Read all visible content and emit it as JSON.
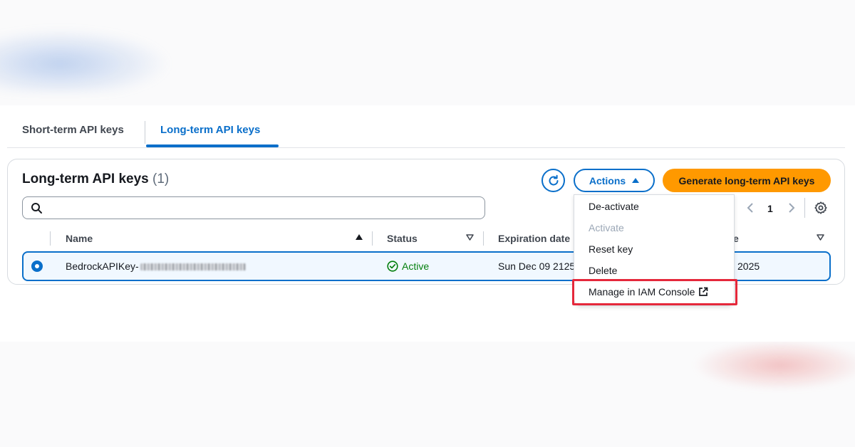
{
  "tabs": {
    "short_term": "Short-term API keys",
    "long_term": "Long-term API keys",
    "active": "long_term"
  },
  "card": {
    "title": "Long-term API keys",
    "count": "(1)"
  },
  "toolbar": {
    "refresh_icon": "refresh-icon",
    "actions_label": "Actions",
    "generate_label": "Generate long-term API keys"
  },
  "search": {
    "placeholder": "",
    "value": ""
  },
  "pagination": {
    "current_page": "1"
  },
  "table": {
    "columns": [
      "Name",
      "Status",
      "Expiration date",
      "Last used date"
    ],
    "visible_header_fragment": "e",
    "rows": [
      {
        "selected": true,
        "name_prefix": "BedrockAPIKey-",
        "name_masked": true,
        "status": "Active",
        "expiration_date": "Sun Dec 09 2125",
        "last_used_fragment": "2025"
      }
    ]
  },
  "actions_menu": {
    "items": [
      {
        "label": "De-activate",
        "disabled": false
      },
      {
        "label": "Activate",
        "disabled": true
      },
      {
        "label": "Reset key",
        "disabled": false
      },
      {
        "label": "Delete",
        "disabled": false
      },
      {
        "label": "Manage in IAM Console",
        "disabled": false,
        "external": true
      }
    ],
    "highlighted_item": "Manage in IAM Console"
  },
  "colors": {
    "accent": "#0a6fca",
    "primary_button": "#ff9900",
    "status_active": "#037f0c",
    "highlight": "#e5283b"
  }
}
